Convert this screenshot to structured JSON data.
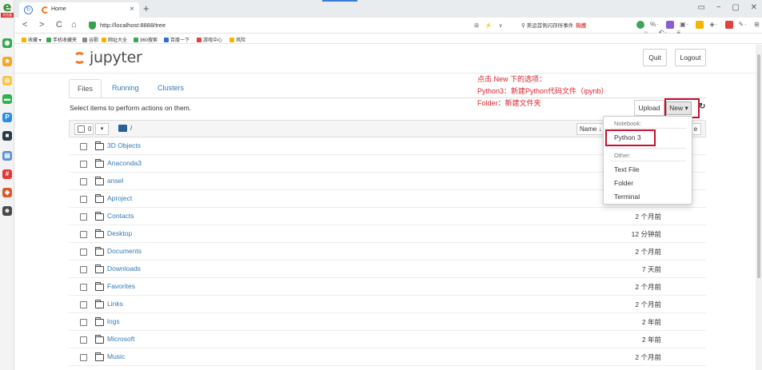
{
  "browser": {
    "tab_title": "Home",
    "url": "http://localhost:8888/tree",
    "search_text": "美运首例闪存所事件",
    "search_hot": "热搜",
    "window_controls": [
      "▭",
      "−",
      "▢",
      "✕"
    ],
    "address_right_icons": "⊞ ⚡ ∨",
    "toolbar_icons": [
      "%·",
      "▣·",
      "◈·",
      "✎·",
      "⊞",
      "☼",
      "↶·",
      "≡"
    ],
    "nav": {
      "back": "<",
      "forward": ">",
      "reload": "C",
      "home": "⌂"
    }
  },
  "bookmarks": [
    {
      "label": "收藏 ▾",
      "color": "#f5b400"
    },
    {
      "label": "手机收藏夹",
      "color": "#3aa757"
    },
    {
      "label": "谷歌",
      "color": "#888888"
    },
    {
      "label": "网址大全",
      "color": "#f5b400"
    },
    {
      "label": "360搜索",
      "color": "#3aa757"
    },
    {
      "label": "百度一下",
      "color": "#2f6fd0"
    },
    {
      "label": "游戏中心",
      "color": "#e0433d"
    },
    {
      "label": "风险",
      "color": "#f5b400"
    }
  ],
  "jupyter": {
    "logo_text": "jupyter",
    "quit_label": "Quit",
    "logout_label": "Logout",
    "tabs": [
      "Files",
      "Running",
      "Clusters"
    ],
    "select_message": "Select items to perform actions on them.",
    "upload_label": "Upload",
    "new_label": "New ▾",
    "refresh_icon": "↻",
    "selected_count": "0",
    "path": "/",
    "name_sort": "Name ↓",
    "edge_label": "e"
  },
  "annotation": {
    "line1": "点击 New 下的选项：",
    "line2": "Python3：新建Python代码文件（ipynb）",
    "line3": "Folder：新建文件夹"
  },
  "dropdown": {
    "notebook_header": "Notebook:",
    "python3": "Python 3",
    "other_header": "Other:",
    "items": [
      "Text File",
      "Folder",
      "Terminal"
    ]
  },
  "files": [
    {
      "name": "3D Objects",
      "time": ""
    },
    {
      "name": "Anaconda3",
      "time": ""
    },
    {
      "name": "ansel",
      "time": ""
    },
    {
      "name": "Aproject",
      "time": ""
    },
    {
      "name": "Contacts",
      "time": "2 个月前"
    },
    {
      "name": "Desktop",
      "time": "12 分钟前"
    },
    {
      "name": "Documents",
      "time": "2 个月前"
    },
    {
      "name": "Downloads",
      "time": "7 天前"
    },
    {
      "name": "Favorites",
      "time": "2 个月前"
    },
    {
      "name": "Links",
      "time": "2 个月前"
    },
    {
      "name": "logs",
      "time": "2 年前"
    },
    {
      "name": "Microsoft",
      "time": "2 年前"
    },
    {
      "name": "Music",
      "time": "2 个月前"
    }
  ],
  "leftbar_icons": [
    {
      "name": "globe-app-icon",
      "color": "#35a852",
      "glyph": "◉"
    },
    {
      "name": "star-app-icon",
      "color": "#f5a623",
      "glyph": "★"
    },
    {
      "name": "weibo-app-icon",
      "color": "#f6c343",
      "glyph": "◎"
    },
    {
      "name": "green-app-icon",
      "color": "#2db34a",
      "glyph": "▬"
    },
    {
      "name": "p-app-icon",
      "color": "#2a8de8",
      "glyph": "P"
    },
    {
      "name": "dark-app-icon",
      "color": "#2b3a4a",
      "glyph": "■"
    },
    {
      "name": "doc-app-icon",
      "color": "#5b8dd6",
      "glyph": "▤"
    },
    {
      "name": "sale-app-icon",
      "color": "#e03a3a",
      "glyph": "#"
    },
    {
      "name": "game-app-icon",
      "color": "#d9592a",
      "glyph": "◆"
    },
    {
      "name": "face-app-icon",
      "color": "#4a4a4a",
      "glyph": "☻"
    }
  ]
}
